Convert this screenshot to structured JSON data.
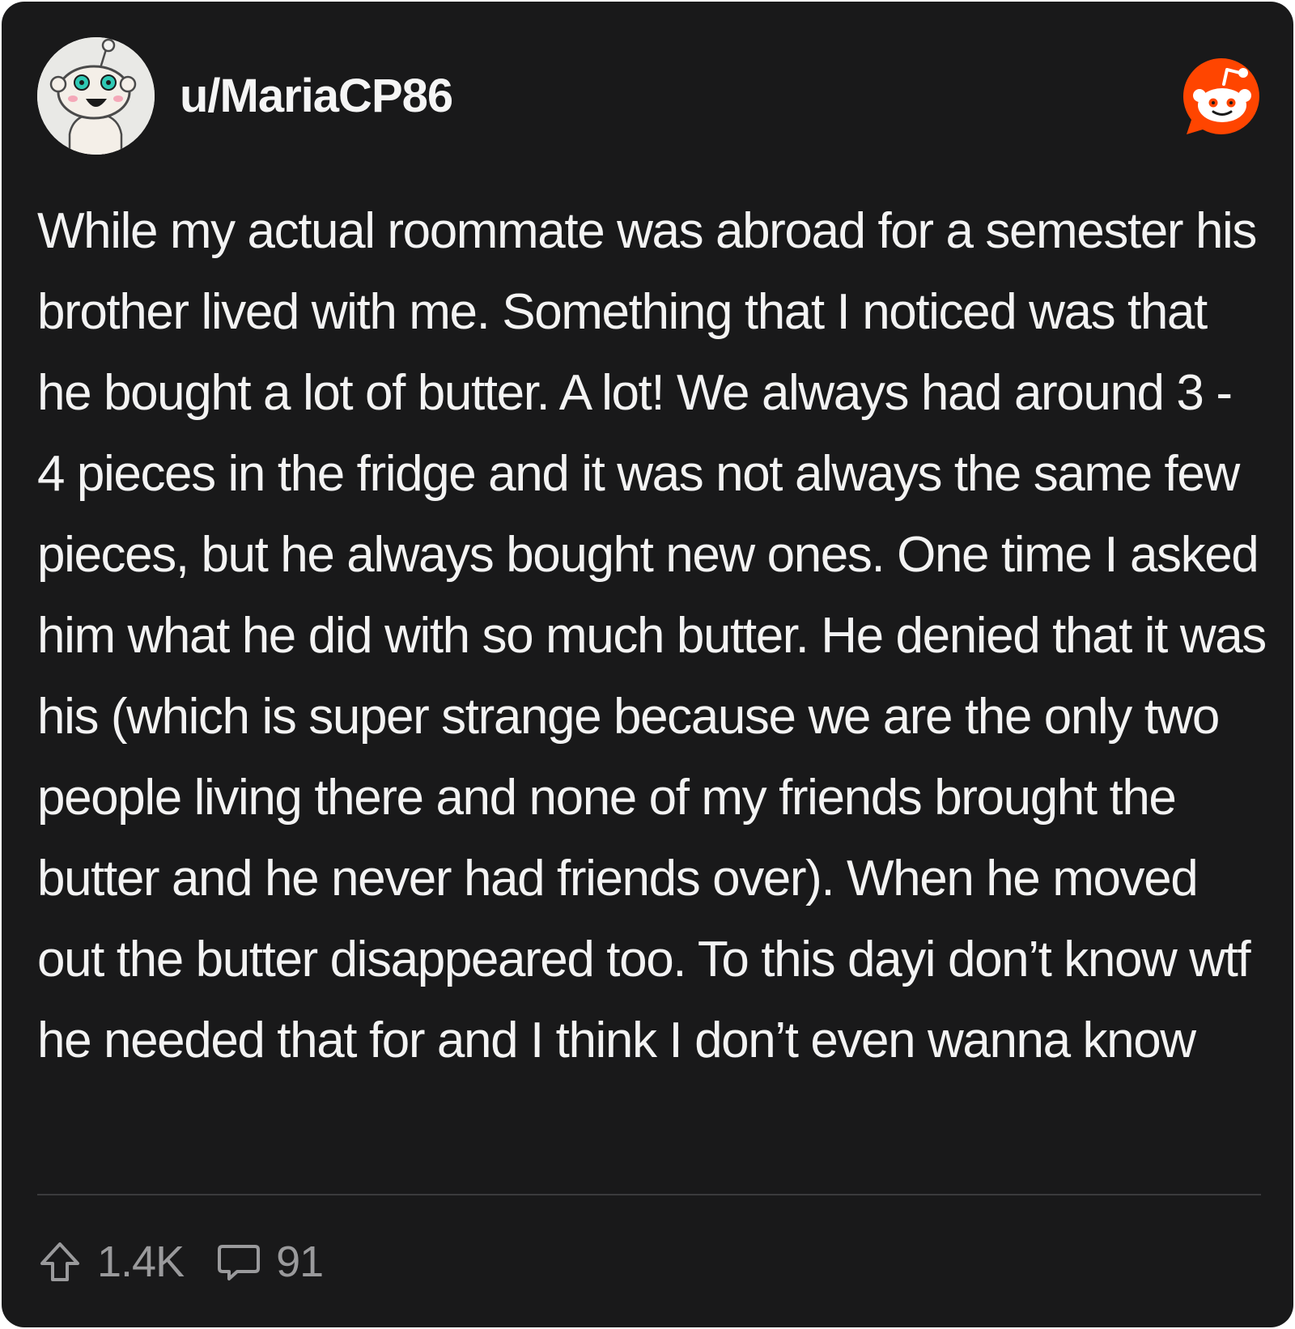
{
  "post": {
    "username": "u/MariaCP86",
    "body": "While my actual roommate was abroad for a semester his brother lived with me. Something that I noticed was that he bought a lot of butter. A lot! We always had around 3 - 4 pieces in the fridge and it was not always the same few pieces, but he always bought new ones. One time I asked him what he did with so much butter. He denied that it was his (which is super strange because we are the only two people living there and none of my friends brought the butter and he never had friends over). When he moved out the butter disappeared too. To this dayi don’t know wtf he needed that for and I think I don’t even wanna know"
  },
  "stats": {
    "upvotes": "1.4K",
    "comments": "91"
  },
  "icons": {
    "avatar": "snoo-avatar",
    "logo": "reddit-logo-icon",
    "upvote": "upvote-arrow-icon",
    "comment": "comment-bubble-icon"
  },
  "colors": {
    "background": "#19191a",
    "text": "#f3f3f3",
    "muted": "#9a9a9c",
    "reddit_orange": "#ff4500"
  }
}
